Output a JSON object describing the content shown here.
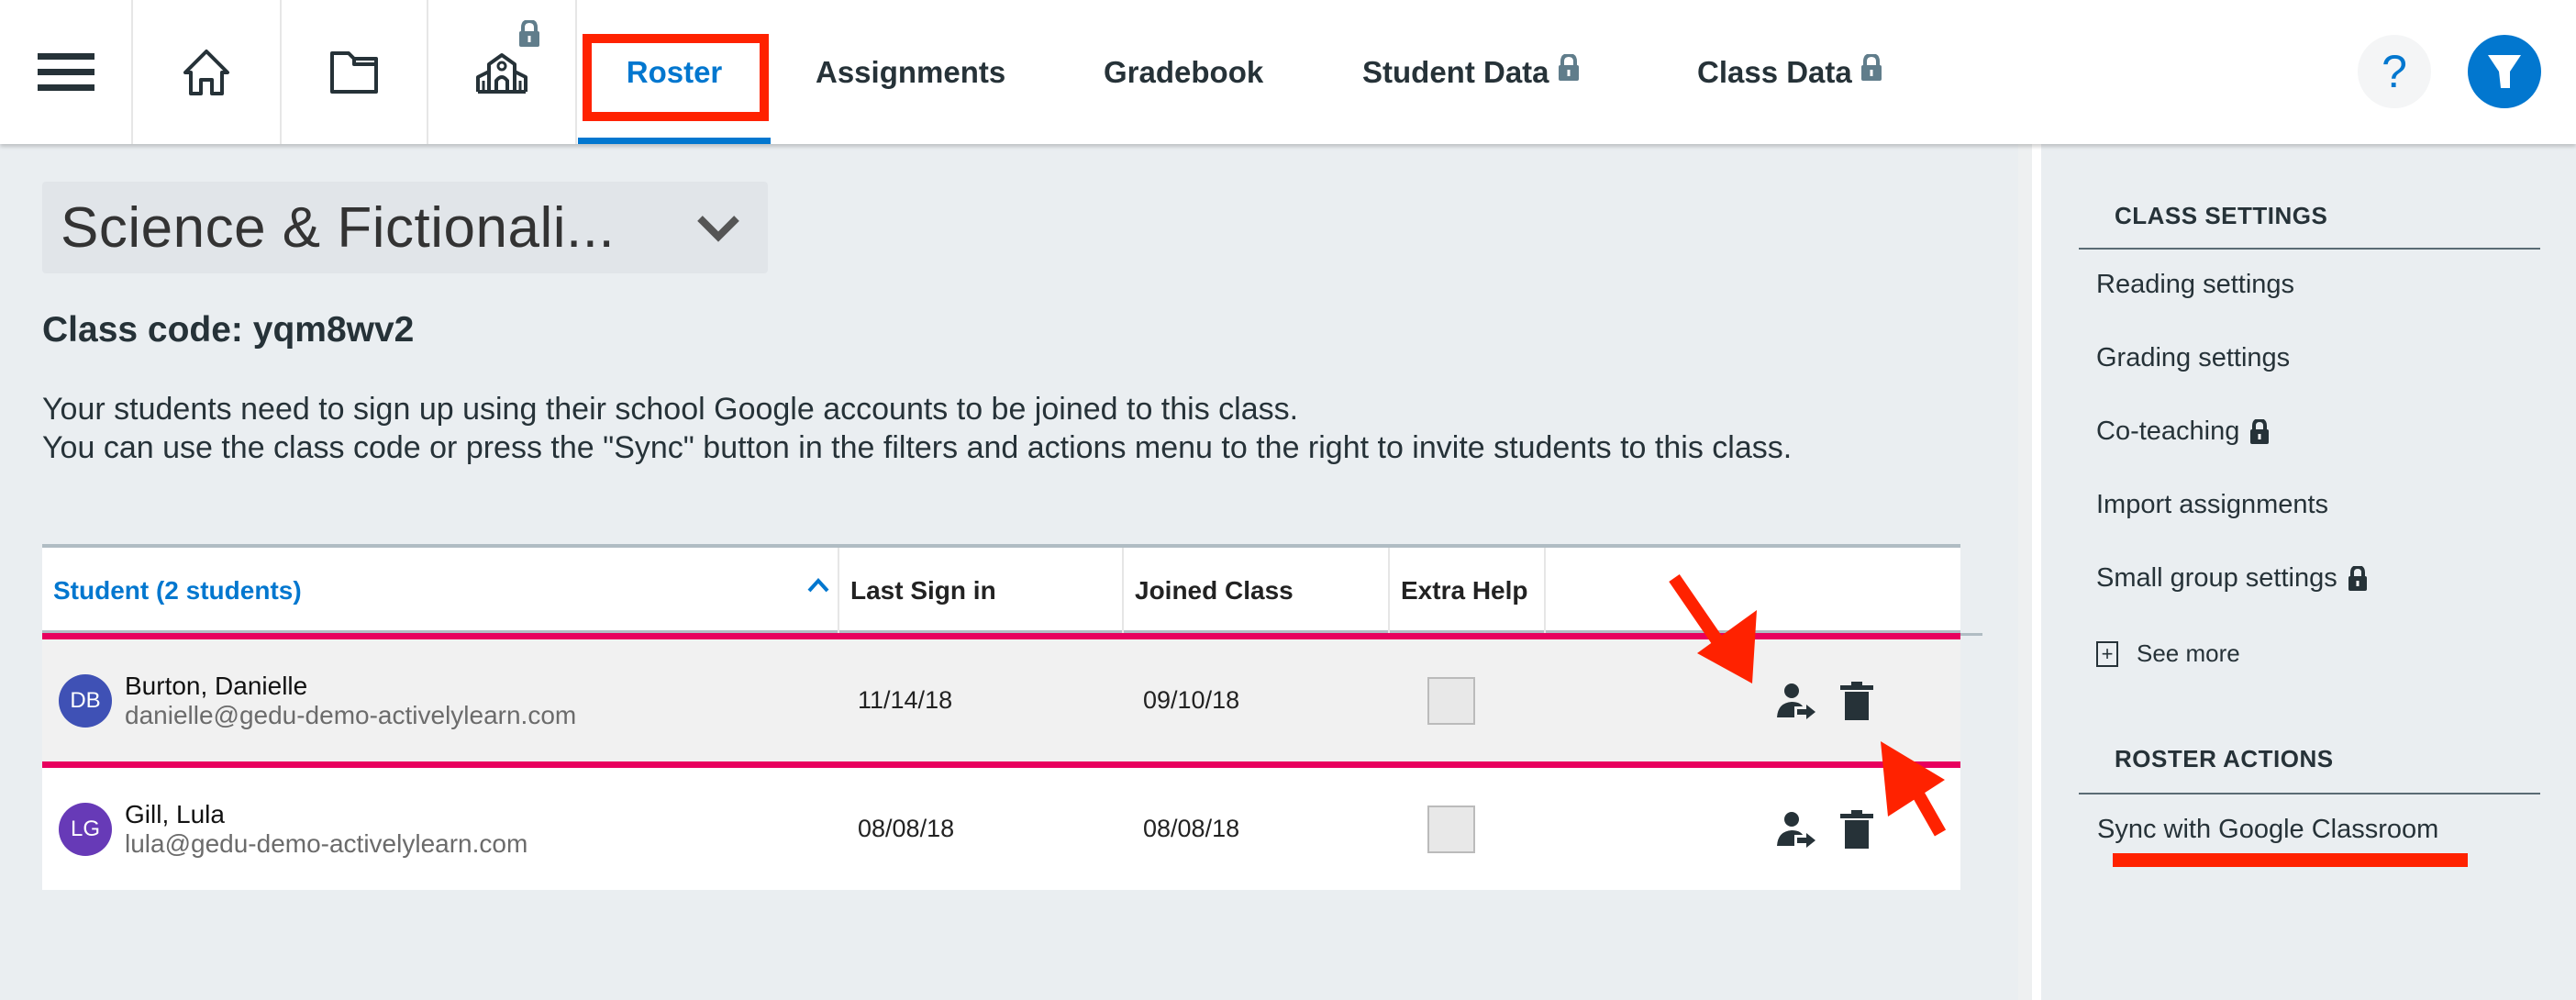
{
  "header": {
    "icons": {
      "menu": "hamburger-menu-icon",
      "home": "home-icon",
      "library": "folder-icon",
      "school": "school-icon",
      "school_locked": true
    },
    "tabs": [
      {
        "label": "Roster",
        "active": true,
        "locked": false
      },
      {
        "label": "Assignments",
        "active": false,
        "locked": false
      },
      {
        "label": "Gradebook",
        "active": false,
        "locked": false
      },
      {
        "label": "Student Data",
        "active": false,
        "locked": true
      },
      {
        "label": "Class Data",
        "active": false,
        "locked": true
      }
    ],
    "help_label": "?",
    "accent_color": "#0277cf"
  },
  "main": {
    "class_name": "Science & Fictionali...",
    "class_code_label": "Class code: yqm8wv2",
    "description": [
      "Your students need to sign up using their school Google accounts to be joined to this class.",
      "You can use the class code or press the \"Sync\" button in the filters and actions menu to the right to invite students to this class."
    ],
    "table": {
      "columns": [
        "Student (2 students)",
        "Last Sign in",
        "Joined Class",
        "Extra Help",
        ""
      ],
      "rows": [
        {
          "initials": "DB",
          "avatar_color": "#3f51b5",
          "name": "Burton, Danielle",
          "email": "danielle@gedu-demo-activelylearn.com",
          "last_sign_in": "11/14/18",
          "joined_class": "09/10/18",
          "extra_help": false,
          "selected": true
        },
        {
          "initials": "LG",
          "avatar_color": "#673ab7",
          "name": "Gill, Lula",
          "email": "lula@gedu-demo-activelylearn.com",
          "last_sign_in": "08/08/18",
          "joined_class": "08/08/18",
          "extra_help": false,
          "selected": false
        }
      ]
    }
  },
  "sidebar": {
    "class_settings_heading": "CLASS SETTINGS",
    "class_settings_items": [
      {
        "label": "Reading settings",
        "locked": false
      },
      {
        "label": "Grading settings",
        "locked": false
      },
      {
        "label": "Co-teaching",
        "locked": true
      },
      {
        "label": "Import assignments",
        "locked": false
      },
      {
        "label": "Small group settings",
        "locked": true
      }
    ],
    "see_more_label": "See more",
    "roster_actions_heading": "ROSTER ACTIONS",
    "roster_actions_items": [
      {
        "label": "Sync with Google Classroom"
      }
    ]
  },
  "annotations": {
    "highlight_color": "#ff2200",
    "selected_row_border_color": "#e8005e"
  }
}
